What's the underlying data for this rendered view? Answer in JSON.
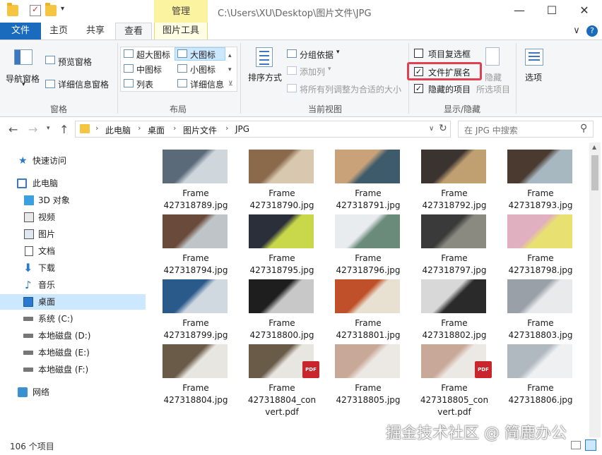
{
  "window": {
    "title_path": "C:\\Users\\XU\\Desktop\\图片文件\\JPG",
    "context_tab": "管理",
    "controls": {
      "minimize": "—",
      "maximize": "☐",
      "close": "✕"
    }
  },
  "tabs": {
    "file": "文件",
    "home": "主页",
    "share": "共享",
    "view": "查看",
    "picture_tools": "图片工具",
    "collapse": "∨",
    "help": "?"
  },
  "ribbon": {
    "panes": {
      "nav_pane": "导航窗格",
      "preview_pane": "预览窗格",
      "details_pane": "详细信息窗格",
      "group": "窗格"
    },
    "layout": {
      "extra_large": "超大图标",
      "large": "大图标",
      "medium": "中图标",
      "small": "小图标",
      "list": "列表",
      "details": "详细信息",
      "group": "布局"
    },
    "current_view": {
      "sort_by": "排序方式",
      "group_by": "分组依据",
      "add_column": "添加列",
      "fit_columns": "将所有列调整为合适的大小",
      "group": "当前视图"
    },
    "show_hide": {
      "item_checkboxes": "项目复选框",
      "item_checkboxes_checked": false,
      "file_extensions": "文件扩展名",
      "file_extensions_checked": true,
      "hidden_items": "隐藏的项目",
      "hidden_items_checked": true,
      "hide_selected": "隐藏",
      "hide_selected_sub": "所选项目",
      "group": "显示/隐藏",
      "highlight_color": "#e04050"
    },
    "options": {
      "label": "选项"
    }
  },
  "address": {
    "crumbs": [
      "此电脑",
      "桌面",
      "图片文件",
      "JPG"
    ],
    "search_placeholder": "在 JPG 中搜索"
  },
  "nav": {
    "quick_access": "快速访问",
    "this_pc": "此电脑",
    "objects3d": "3D 对象",
    "videos": "视频",
    "pictures": "图片",
    "documents": "文档",
    "downloads": "下载",
    "music": "音乐",
    "desktop": "桌面",
    "drive_c": "系统 (C:)",
    "drive_d": "本地磁盘 (D:)",
    "drive_e": "本地磁盘 (E:)",
    "drive_f": "本地磁盘 (F:)",
    "network": "网络"
  },
  "files": [
    {
      "l1": "Frame",
      "l2": "427318789.jpg",
      "c1": "#5a6a78",
      "c2": "#cfd6dc"
    },
    {
      "l1": "Frame",
      "l2": "427318790.jpg",
      "c1": "#8a6a4a",
      "c2": "#d9c8b0"
    },
    {
      "l1": "Frame",
      "l2": "427318791.jpg",
      "c1": "#c9a27a",
      "c2": "#3d5b6a"
    },
    {
      "l1": "Frame",
      "l2": "427318792.jpg",
      "c1": "#3a3330",
      "c2": "#c0a070"
    },
    {
      "l1": "Frame",
      "l2": "427318793.jpg",
      "c1": "#4a3a30",
      "c2": "#a8b8c0"
    },
    {
      "l1": "Frame",
      "l2": "427318794.jpg",
      "c1": "#6a4a3a",
      "c2": "#bfc4c8"
    },
    {
      "l1": "Frame",
      "l2": "427318795.jpg",
      "c1": "#2a2f3a",
      "c2": "#c8d84a"
    },
    {
      "l1": "Frame",
      "l2": "427318796.jpg",
      "c1": "#e8ecef",
      "c2": "#6a8a7a"
    },
    {
      "l1": "Frame",
      "l2": "427318797.jpg",
      "c1": "#3a3a3a",
      "c2": "#8a8a80"
    },
    {
      "l1": "Frame",
      "l2": "427318798.jpg",
      "c1": "#e0b0c0",
      "c2": "#e8e070"
    },
    {
      "l1": "Frame",
      "l2": "427318799.jpg",
      "c1": "#2a5a8a",
      "c2": "#d0d8e0"
    },
    {
      "l1": "Frame",
      "l2": "427318800.jpg",
      "c1": "#1e1e1e",
      "c2": "#c8c8c8"
    },
    {
      "l1": "Frame",
      "l2": "427318801.jpg",
      "c1": "#c0502a",
      "c2": "#e8e0d0"
    },
    {
      "l1": "Frame",
      "l2": "427318802.jpg",
      "c1": "#d8d8d8",
      "c2": "#2a2a2a"
    },
    {
      "l1": "Frame",
      "l2": "427318803.jpg",
      "c1": "#9aa0a8",
      "c2": "#e8eaec"
    },
    {
      "l1": "Frame",
      "l2": "427318804.jpg",
      "c1": "#6a5a48",
      "c2": "#e8e6e0"
    },
    {
      "l1": "Frame",
      "l2": "427318804_con",
      "l3": "vert.pdf",
      "c1": "#6a5a48",
      "c2": "#e8e6e0",
      "pdf": "PDF"
    },
    {
      "l1": "Frame",
      "l2": "427318805.jpg",
      "c1": "#c8a898",
      "c2": "#ece8e4"
    },
    {
      "l1": "Frame",
      "l2": "427318805_con",
      "l3": "vert.pdf",
      "c1": "#c8a898",
      "c2": "#ece8e4",
      "pdf": "PDF"
    },
    {
      "l1": "Frame",
      "l2": "427318806.jpg",
      "c1": "#b0b8c0",
      "c2": "#eef0f2"
    }
  ],
  "status": {
    "count": "106 个项目"
  },
  "watermark": "掘金技术社区 @ 简鹿办公"
}
